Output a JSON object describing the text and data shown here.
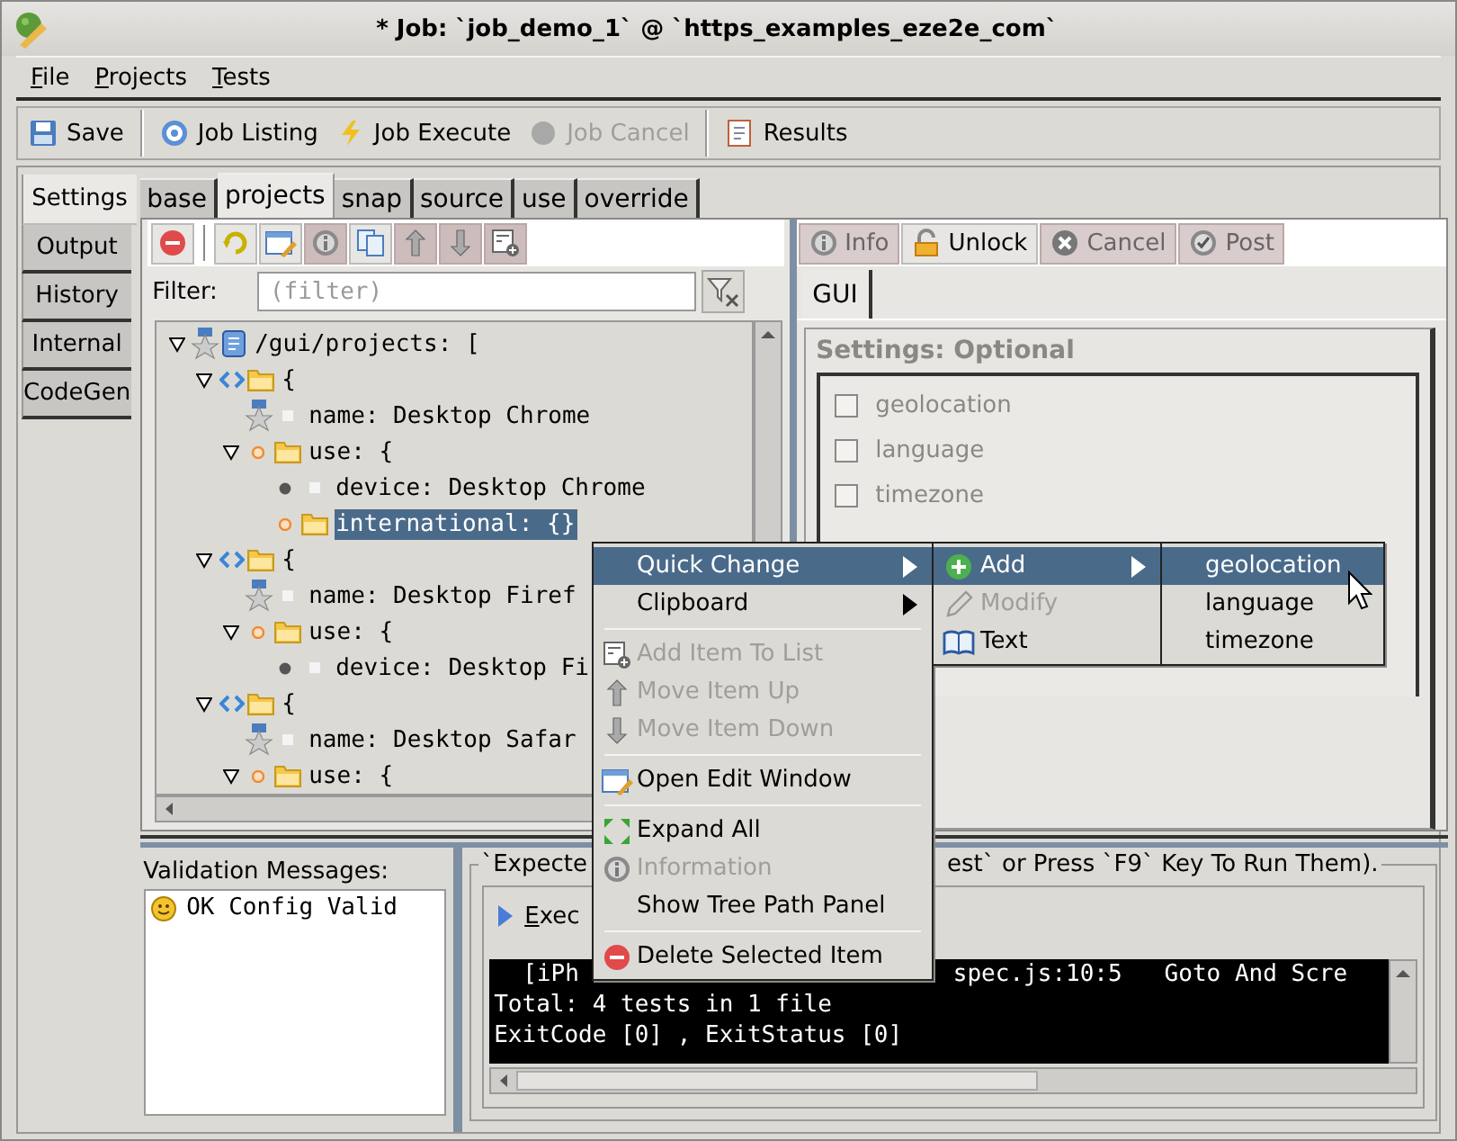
{
  "window": {
    "title": "* Job: `job_demo_1` @ `https_examples_eze2e_com`"
  },
  "menu_bar": [
    "File",
    "Projects",
    "Tests"
  ],
  "toolbar": [
    {
      "kind": "button",
      "label": "Save",
      "disabled": false
    },
    {
      "kind": "separator"
    },
    {
      "kind": "button",
      "label": "Job Listing",
      "disabled": false
    },
    {
      "kind": "button",
      "label": "Job Execute",
      "disabled": false
    },
    {
      "kind": "button",
      "label": "Job Cancel",
      "disabled": true
    },
    {
      "kind": "separator"
    },
    {
      "kind": "button",
      "label": "Results",
      "disabled": false
    }
  ],
  "side_tabs": [
    {
      "label": "Settings",
      "selected": true
    },
    {
      "label": "Output",
      "selected": false
    },
    {
      "label": "History",
      "selected": false
    },
    {
      "label": "Internal",
      "selected": false
    },
    {
      "label": "CodeGen",
      "selected": false
    }
  ],
  "settings_tabs": [
    {
      "label": "base",
      "selected": false
    },
    {
      "label": "projects",
      "selected": true
    },
    {
      "label": "snap",
      "selected": false
    },
    {
      "label": "source",
      "selected": false
    },
    {
      "label": "use",
      "selected": false
    },
    {
      "label": "override",
      "selected": false
    }
  ],
  "tree_tools": [
    {
      "disabled": false
    },
    {
      "disabled": false
    },
    {
      "disabled": false
    },
    {
      "disabled": true
    },
    {
      "disabled": false
    },
    {
      "disabled": true
    },
    {
      "disabled": true
    },
    {
      "disabled": true
    }
  ],
  "filter": {
    "label": "Filter:",
    "placeholder": "(filter)"
  },
  "tree": {
    "label": "/gui/projects: [",
    "kind": "list",
    "expanded": true,
    "selected": false,
    "children": [
      {
        "label": "{",
        "kind": "entry",
        "expanded": true,
        "selected": false,
        "children": [
          {
            "label": "name: Desktop Chrome",
            "kind": "key",
            "selected": false
          },
          {
            "label": "use: {",
            "kind": "map",
            "expanded": true,
            "selected": false,
            "children": [
              {
                "label": "device: Desktop Chrome",
                "kind": "field",
                "selected": false
              },
              {
                "label": "international: {}",
                "kind": "map",
                "selected": true
              }
            ]
          }
        ]
      },
      {
        "label": "{",
        "kind": "entry",
        "expanded": true,
        "selected": false,
        "children": [
          {
            "label": "name: Desktop Firef",
            "kind": "key",
            "selected": false
          },
          {
            "label": "use: {",
            "kind": "map",
            "expanded": true,
            "selected": false,
            "children": [
              {
                "label": "device: Desktop Fi",
                "kind": "field",
                "selected": false
              }
            ]
          }
        ]
      },
      {
        "label": "{",
        "kind": "entry",
        "expanded": true,
        "selected": false,
        "children": [
          {
            "label": "name: Desktop Safar",
            "kind": "key",
            "selected": false
          },
          {
            "label": "use: {",
            "kind": "map",
            "expanded": true,
            "selected": false
          }
        ]
      }
    ]
  },
  "action_buttons": [
    {
      "label": "Info",
      "disabled": true
    },
    {
      "label": "Unlock",
      "disabled": false
    },
    {
      "label": "Cancel",
      "disabled": true
    },
    {
      "label": "Post",
      "disabled": true
    }
  ],
  "gui_tabs": [
    {
      "label": "GUI",
      "selected": true
    }
  ],
  "optional_settings": {
    "title": "Settings: Optional",
    "disabled": true,
    "items": [
      {
        "label": "geolocation",
        "checked": false
      },
      {
        "label": "language",
        "checked": false
      },
      {
        "label": "timezone",
        "checked": false
      }
    ]
  },
  "validation": {
    "title": "Validation Messages:",
    "messages": [
      "OK Config Valid"
    ]
  },
  "output": {
    "title_parts": [
      "`Expecte",
      "est` or Press `F9` Key To Run Them)."
    ],
    "run_button": "Exec",
    "console": [
      [
        "[iPh",
        "spec.js:10:5   Goto And Scre"
      ],
      [
        "Total: 4 tests in 1 file"
      ],
      [
        "ExitCode [0] , ExitStatus [0]"
      ]
    ]
  },
  "context_menu": [
    {
      "kind": "item",
      "label": "Quick Change",
      "disabled": false,
      "selected": true,
      "submenu": true
    },
    {
      "kind": "item",
      "label": "Clipboard",
      "disabled": false,
      "selected": false,
      "submenu": true
    },
    {
      "kind": "separator"
    },
    {
      "kind": "item",
      "label": "Add Item To List",
      "disabled": true,
      "selected": false,
      "submenu": false
    },
    {
      "kind": "item",
      "label": "Move Item Up",
      "disabled": true,
      "selected": false,
      "submenu": false
    },
    {
      "kind": "item",
      "label": "Move Item Down",
      "disabled": true,
      "selected": false,
      "submenu": false
    },
    {
      "kind": "separator"
    },
    {
      "kind": "item",
      "label": "Open Edit Window",
      "disabled": false,
      "selected": false,
      "submenu": false
    },
    {
      "kind": "separator"
    },
    {
      "kind": "item",
      "label": "Expand All",
      "disabled": false,
      "selected": false,
      "submenu": false
    },
    {
      "kind": "item",
      "label": "Information",
      "disabled": true,
      "selected": false,
      "submenu": false
    },
    {
      "kind": "item",
      "label": "Show Tree Path Panel",
      "disabled": false,
      "selected": false,
      "submenu": false
    },
    {
      "kind": "separator"
    },
    {
      "kind": "item",
      "label": "Delete Selected Item",
      "disabled": false,
      "selected": false,
      "submenu": false
    }
  ],
  "quick_change_menu": [
    {
      "kind": "item",
      "label": "Add",
      "disabled": false,
      "selected": true,
      "submenu": true
    },
    {
      "kind": "item",
      "label": "Modify",
      "disabled": true,
      "selected": false,
      "submenu": false
    },
    {
      "kind": "item",
      "label": "Text",
      "disabled": false,
      "selected": false,
      "submenu": false
    }
  ],
  "add_menu": [
    {
      "kind": "item",
      "label": "geolocation",
      "disabled": false,
      "selected": true,
      "submenu": false
    },
    {
      "kind": "item",
      "label": "language",
      "disabled": false,
      "selected": false,
      "submenu": false
    },
    {
      "kind": "item",
      "label": "timezone",
      "disabled": false,
      "selected": false,
      "submenu": false
    }
  ]
}
